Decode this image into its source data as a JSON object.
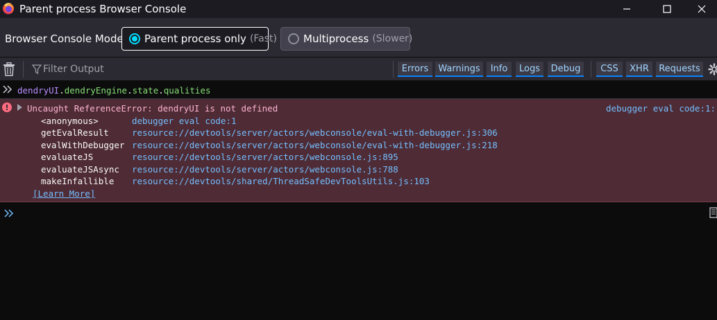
{
  "window": {
    "title": "Parent process Browser Console",
    "icons": {
      "app": "firefox-logo",
      "minimize": "minimize-icon",
      "maximize": "maximize-icon",
      "close": "close-icon"
    }
  },
  "mode_bar": {
    "label": "Browser Console Mode",
    "options": [
      {
        "label": "Parent process only",
        "hint": "(Fast)",
        "selected": true
      },
      {
        "label": "Multiprocess",
        "hint": "(Slower)",
        "selected": false
      }
    ]
  },
  "toolbar": {
    "filter_placeholder": "Filter Output",
    "filters": [
      "Errors",
      "Warnings",
      "Info",
      "Logs",
      "Debug",
      "CSS",
      "XHR",
      "Requests"
    ],
    "icons": {
      "clear": "trash-icon",
      "filter": "filter-icon",
      "settings": "gear-icon"
    }
  },
  "input_echo": {
    "tokens": [
      {
        "text": "dendryUI",
        "kind": "var"
      },
      {
        "text": ".",
        "kind": "punc"
      },
      {
        "text": "dendryEngine",
        "kind": "prop"
      },
      {
        "text": ".",
        "kind": "punc"
      },
      {
        "text": "state",
        "kind": "prop"
      },
      {
        "text": ".",
        "kind": "punc"
      },
      {
        "text": "qualities",
        "kind": "prop"
      }
    ]
  },
  "error": {
    "message": "Uncaught ReferenceError: dendryUI is not defined",
    "source": "debugger eval code:1:",
    "stack": [
      {
        "fn": "<anonymous>",
        "loc": "debugger eval code:1"
      },
      {
        "fn": "getEvalResult",
        "loc": "resource://devtools/server/actors/webconsole/eval-with-debugger.js:306"
      },
      {
        "fn": "evalWithDebugger",
        "loc": "resource://devtools/server/actors/webconsole/eval-with-debugger.js:218"
      },
      {
        "fn": "evaluateJS",
        "loc": "resource://devtools/server/actors/webconsole.js:895"
      },
      {
        "fn": "evaluateJSAsync",
        "loc": "resource://devtools/server/actors/webconsole.js:788"
      },
      {
        "fn": "makeInfallible",
        "loc": "resource://devtools/shared/ThreadSafeDevToolsUtils.js:103"
      }
    ],
    "learn_more": "[Learn More]"
  },
  "input": {
    "value": ""
  },
  "colors": {
    "accent": "#00ddff",
    "error_bg": "#4e2b35",
    "error_text": "#ffb3d2",
    "link": "#75bfff"
  }
}
